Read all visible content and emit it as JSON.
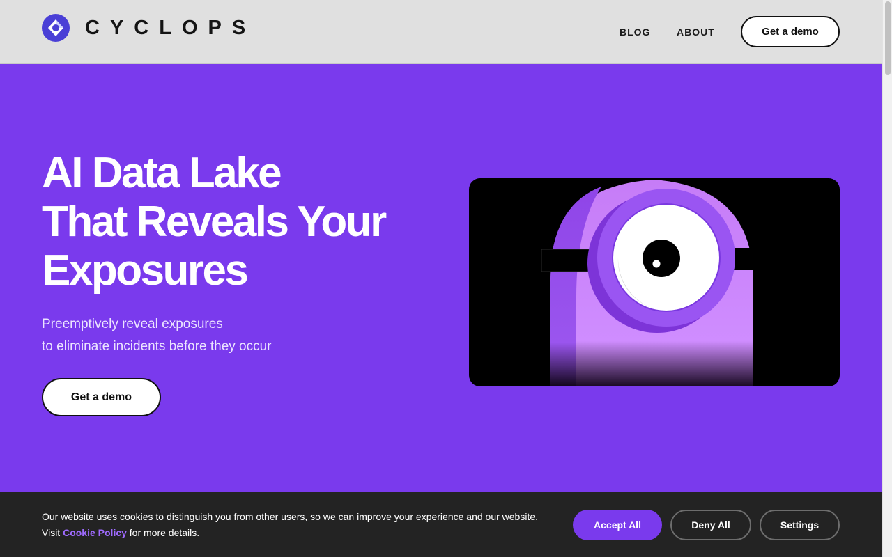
{
  "header": {
    "logo_text": "CYCLOPS",
    "nav": [
      {
        "label": "BLOG"
      },
      {
        "label": "ABOUT"
      }
    ],
    "cta_label": "Get a demo"
  },
  "hero": {
    "title_lines": [
      "AI Data Lake",
      "That Reveals Your",
      "Exposures"
    ],
    "subtitle_lines": [
      "Preemptively reveal exposures",
      "to eliminate incidents before they occur"
    ],
    "cta_label": "Get a demo"
  },
  "cookie_banner": {
    "text_line1": "Our website uses cookies to distinguish you from other users, so we can improve your experience and our website.",
    "text_visit": "Visit ",
    "link_label": "Cookie Policy",
    "text_after": " for more details.",
    "buttons": {
      "accept": "Accept All",
      "deny": "Deny All",
      "settings": "Settings"
    }
  },
  "colors": {
    "brand_purple": "#7a3aed",
    "header_bg": "#e0e0e0",
    "banner_bg": "#232323",
    "link_purple": "#9f6bff"
  },
  "icons": {
    "logo": "cyclops-logo-icon"
  }
}
